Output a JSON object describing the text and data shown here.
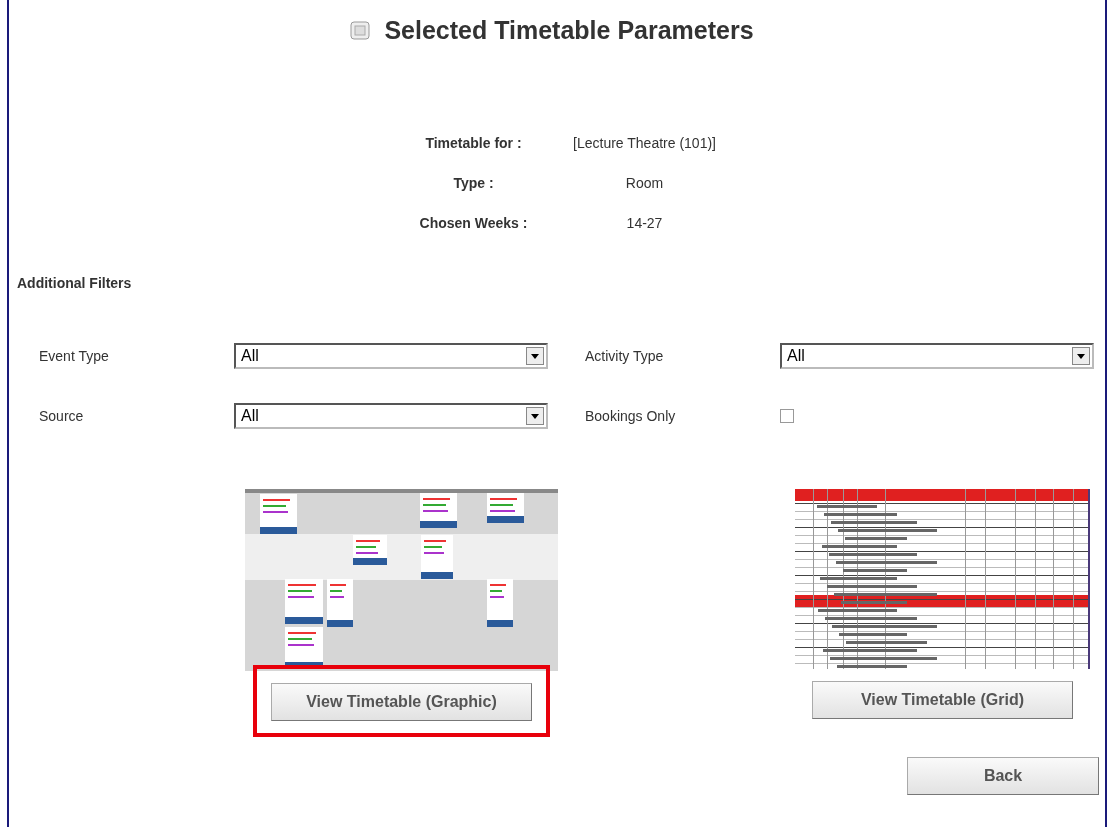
{
  "title": "Selected Timetable Parameters",
  "parameters": [
    {
      "label": "Timetable for :",
      "value": "[Lecture Theatre (101)]"
    },
    {
      "label": "Type :",
      "value": "Room"
    },
    {
      "label": "Chosen Weeks :",
      "value": "14-27"
    }
  ],
  "filters_heading": "Additional Filters",
  "filters": [
    {
      "kind": "select",
      "label": "Event Type",
      "value": "All"
    },
    {
      "kind": "select",
      "label": "Activity Type",
      "value": "All"
    },
    {
      "kind": "select",
      "label": "Source",
      "value": "All"
    },
    {
      "kind": "checkbox",
      "label": "Bookings Only",
      "checked": false
    }
  ],
  "views": [
    {
      "kind": "graphic",
      "button": "View Timetable (Graphic)",
      "highlighted": true
    },
    {
      "kind": "grid",
      "button": "View Timetable (Grid)",
      "highlighted": false
    }
  ],
  "back_button": "Back"
}
